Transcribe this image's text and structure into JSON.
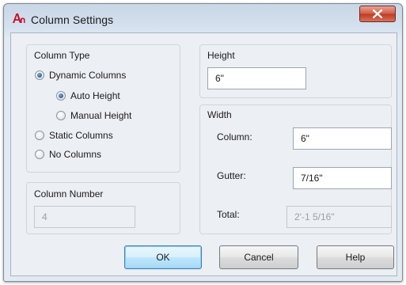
{
  "dialog": {
    "title": "Column Settings",
    "close_label": "✕"
  },
  "column_type": {
    "title": "Column Type",
    "options": [
      {
        "label": "Dynamic Columns",
        "checked": true
      },
      {
        "label": "Auto Height",
        "checked": true
      },
      {
        "label": "Manual Height",
        "checked": false
      },
      {
        "label": "Static Columns",
        "checked": false
      },
      {
        "label": "No Columns",
        "checked": false
      }
    ]
  },
  "column_number": {
    "title": "Column Number",
    "value": "4"
  },
  "height": {
    "title": "Height",
    "value": "6\""
  },
  "width": {
    "title": "Width",
    "column_label": "Column:",
    "column_value": "6\"",
    "gutter_label": "Gutter:",
    "gutter_value": "7/16\"",
    "total_label": "Total:",
    "total_value": "2'-1 5/16\""
  },
  "buttons": {
    "ok": "OK",
    "cancel": "Cancel",
    "help": "Help"
  },
  "colors": {
    "accent": "#3c7fb1",
    "close": "#c23b22"
  }
}
